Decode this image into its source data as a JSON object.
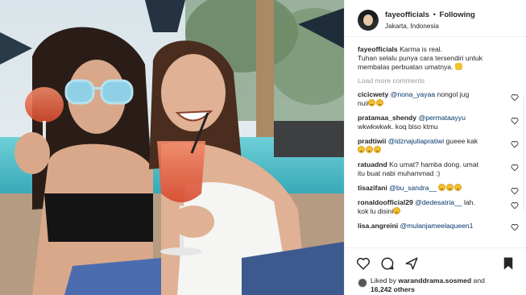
{
  "post": {
    "username": "fayeofficials",
    "separator": "•",
    "follow_label": "Following",
    "location": "Jakarta, Indonesia",
    "caption": "Karma is real.\nTuhan selalu punya cara tersendiri untuk membalas perbuatan umatnya. 🙏",
    "caption_line1": "Karma is real.",
    "caption_line2": "Tuhan selalu punya cara tersendiri untuk",
    "caption_line3": "membalas perbuatan umatnya.",
    "load_more": "Load more comments"
  },
  "comments": [
    {
      "user": "cicicwety",
      "mention": "@nona_yayaa",
      "text": " nongol jug",
      "text2": "nuii",
      "emojis": 2
    },
    {
      "user": "pratamaa_shendy",
      "mention": "@permataayyu",
      "text": "",
      "text2": "wkwkwkwk. koq biso ktmu",
      "emojis": 0
    },
    {
      "user": "pradtiwii",
      "mention": "@idznajuliapratiwi",
      "text": " gueee kak",
      "text2": "",
      "emojis": 3
    },
    {
      "user": "ratuadnd",
      "mention": "",
      "text": " Ko umat? hamba dong. umat",
      "text2": "itu buat nabi muhammad :)",
      "emojis": 0
    },
    {
      "user": "tisazifani",
      "mention": "@bu_sandra__",
      "text": " ",
      "text2": "",
      "emojis": 3
    },
    {
      "user": "ronaldoofficial29",
      "mention": "@dedesatria__",
      "text": " lah.",
      "text2": "kok lu disini",
      "emojis": 1
    },
    {
      "user": "lisa.angreini",
      "mention": "@mulanjameelaqueen1",
      "text": "",
      "text2": "",
      "emojis": 0
    }
  ],
  "likes": {
    "prefix": "Liked by",
    "user": "waranddrama.sosmed",
    "middle": "and",
    "count": "16,242 others"
  },
  "icons": {
    "heart": "heart-icon",
    "comment": "comment-icon",
    "share": "share-icon",
    "bookmark": "bookmark-icon"
  }
}
